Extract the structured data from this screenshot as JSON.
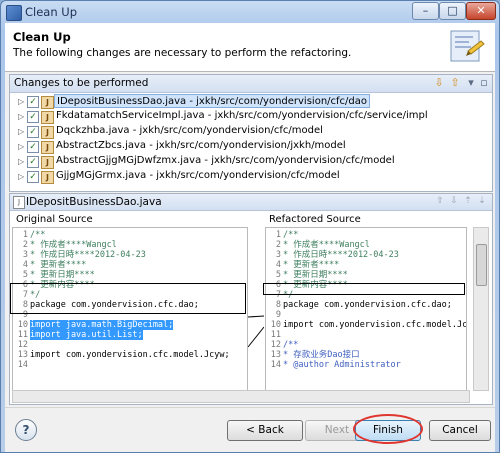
{
  "window": {
    "title": "Clean Up"
  },
  "banner": {
    "title": "Clean Up",
    "description": "The following changes are necessary to perform the refactoring."
  },
  "changes": {
    "title": "Changes to be performed",
    "items": [
      {
        "label": "IDepositBusinessDao.java - jxkh/src/com/yondervision/cfc/dao"
      },
      {
        "label": "FkdatamatchServiceImpl.java - jxkh/src/com/yondervision/cfc/service/impl"
      },
      {
        "label": "Dqckzhba.java - jxkh/src/com/yondervision/cfc/model"
      },
      {
        "label": "AbstractZbcs.java - jxkh/src/com/yondervision/jxkh/model"
      },
      {
        "label": "AbstractGjjgMGjDwfzmx.java - jxkh/src/com/yondervision/cfc/model"
      },
      {
        "label": "GjjgMGjGrmx.java - jxkh/src/com/yondervision/cfc/model"
      }
    ]
  },
  "compare": {
    "title": "IDepositBusinessDao.java",
    "original_label": "Original Source",
    "refactored_label": "Refactored Source",
    "original_lines": [
      {
        "n": "1",
        "text": "/**"
      },
      {
        "n": "2",
        "text": " * 作成者****Wangcl"
      },
      {
        "n": "3",
        "text": " * 作成日時****2012-04-23"
      },
      {
        "n": "4",
        "text": " * 更新者****"
      },
      {
        "n": "5",
        "text": " * 更新日期****"
      },
      {
        "n": "6",
        "text": " * 更新内容****"
      },
      {
        "n": "7",
        "text": " */"
      },
      {
        "n": "8",
        "text": "package com.yondervision.cfc.dao;"
      },
      {
        "n": "9",
        "text": ""
      },
      {
        "n": "10",
        "text": "import java.math.BigDecimal;"
      },
      {
        "n": "11",
        "text": "import java.util.List;"
      },
      {
        "n": "12",
        "text": ""
      },
      {
        "n": "13",
        "text": "import com.yondervision.cfc.model.Jcyw;"
      },
      {
        "n": "14",
        "text": ""
      }
    ],
    "refactored_lines": [
      {
        "n": "1",
        "text": "/**"
      },
      {
        "n": "2",
        "text": " * 作成者****Wangcl"
      },
      {
        "n": "3",
        "text": " * 作成日時****2012-04-23"
      },
      {
        "n": "4",
        "text": " * 更新者****"
      },
      {
        "n": "5",
        "text": " * 更新日期****"
      },
      {
        "n": "6",
        "text": " * 更新内容****"
      },
      {
        "n": "7",
        "text": " */"
      },
      {
        "n": "8",
        "text": "package com.yondervision.cfc.dao;"
      },
      {
        "n": "9",
        "text": ""
      },
      {
        "n": "10",
        "text": "import com.yondervision.cfc.model.Jcyw;"
      },
      {
        "n": "11",
        "text": ""
      },
      {
        "n": "12",
        "text": "/**"
      },
      {
        "n": "13",
        "text": " * 存款业务Dao接口"
      },
      {
        "n": "14",
        "text": " * @author Administrator"
      }
    ]
  },
  "buttons": {
    "help": "?",
    "back": "< Back",
    "next": "Next >",
    "finish": "Finish",
    "cancel": "Cancel"
  }
}
